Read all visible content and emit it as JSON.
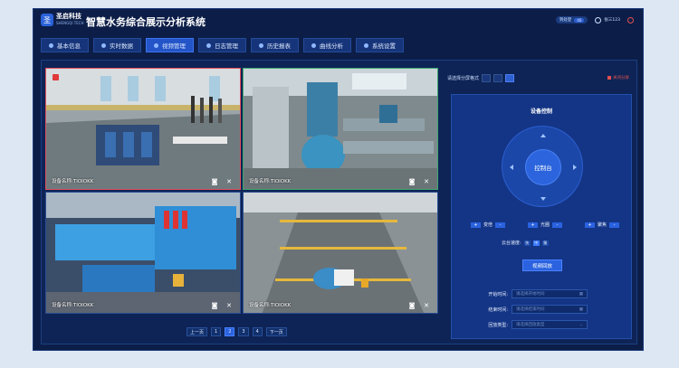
{
  "header": {
    "logo_mark": "圣",
    "logo_cn": "圣启科技",
    "logo_en": "SHENGQI TECH",
    "title": "智慧水务综合展示分析系统",
    "tag_label": "到处登",
    "tag_count": "46",
    "user": "张三123"
  },
  "nav": [
    {
      "label": "基本信息"
    },
    {
      "label": "实时数据"
    },
    {
      "label": "视频管理"
    },
    {
      "label": "日志管理"
    },
    {
      "label": "历史报表"
    },
    {
      "label": "曲线分析"
    },
    {
      "label": "系统设置"
    }
  ],
  "nav_active_index": 2,
  "cameras": [
    {
      "label": "设备名称:TIOIOKK"
    },
    {
      "label": "设备名称:TIOIOKK"
    },
    {
      "label": "设备名称:TIOIOKK"
    },
    {
      "label": "设备名称:TIOIOKK"
    }
  ],
  "pager": {
    "prev": "上一页",
    "pages": [
      "1",
      "2",
      "3",
      "4"
    ],
    "active": "2",
    "next": "下一页"
  },
  "split": {
    "label": "请选择分屏格式",
    "exit": "关闭分屏"
  },
  "control": {
    "title": "设备控制",
    "center": "控制台",
    "zoom": "变倍",
    "aperture": "光圈",
    "focus": "聚焦",
    "plus": "+",
    "minus": "-",
    "speed_label": "云台速度:",
    "speeds": [
      "快",
      "中",
      "慢"
    ],
    "replay": "视频回放",
    "start_label": "开始时间:",
    "start_placeholder": "请选择开始时间",
    "end_label": "结束时间:",
    "end_placeholder": "请选择结束时间",
    "type_label": "回放类型:",
    "type_placeholder": "请选择回放类型"
  }
}
